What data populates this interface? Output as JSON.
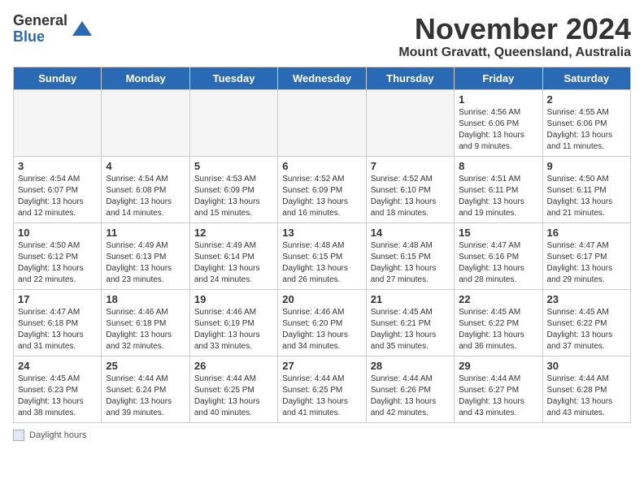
{
  "logo": {
    "general": "General",
    "blue": "Blue"
  },
  "title": "November 2024",
  "subtitle": "Mount Gravatt, Queensland, Australia",
  "days_of_week": [
    "Sunday",
    "Monday",
    "Tuesday",
    "Wednesday",
    "Thursday",
    "Friday",
    "Saturday"
  ],
  "footer_label": "Daylight hours",
  "weeks": [
    [
      {
        "day": "",
        "info": ""
      },
      {
        "day": "",
        "info": ""
      },
      {
        "day": "",
        "info": ""
      },
      {
        "day": "",
        "info": ""
      },
      {
        "day": "",
        "info": ""
      },
      {
        "day": "1",
        "info": "Sunrise: 4:56 AM\nSunset: 6:06 PM\nDaylight: 13 hours\nand 9 minutes."
      },
      {
        "day": "2",
        "info": "Sunrise: 4:55 AM\nSunset: 6:06 PM\nDaylight: 13 hours\nand 11 minutes."
      }
    ],
    [
      {
        "day": "3",
        "info": "Sunrise: 4:54 AM\nSunset: 6:07 PM\nDaylight: 13 hours\nand 12 minutes."
      },
      {
        "day": "4",
        "info": "Sunrise: 4:54 AM\nSunset: 6:08 PM\nDaylight: 13 hours\nand 14 minutes."
      },
      {
        "day": "5",
        "info": "Sunrise: 4:53 AM\nSunset: 6:09 PM\nDaylight: 13 hours\nand 15 minutes."
      },
      {
        "day": "6",
        "info": "Sunrise: 4:52 AM\nSunset: 6:09 PM\nDaylight: 13 hours\nand 16 minutes."
      },
      {
        "day": "7",
        "info": "Sunrise: 4:52 AM\nSunset: 6:10 PM\nDaylight: 13 hours\nand 18 minutes."
      },
      {
        "day": "8",
        "info": "Sunrise: 4:51 AM\nSunset: 6:11 PM\nDaylight: 13 hours\nand 19 minutes."
      },
      {
        "day": "9",
        "info": "Sunrise: 4:50 AM\nSunset: 6:11 PM\nDaylight: 13 hours\nand 21 minutes."
      }
    ],
    [
      {
        "day": "10",
        "info": "Sunrise: 4:50 AM\nSunset: 6:12 PM\nDaylight: 13 hours\nand 22 minutes."
      },
      {
        "day": "11",
        "info": "Sunrise: 4:49 AM\nSunset: 6:13 PM\nDaylight: 13 hours\nand 23 minutes."
      },
      {
        "day": "12",
        "info": "Sunrise: 4:49 AM\nSunset: 6:14 PM\nDaylight: 13 hours\nand 24 minutes."
      },
      {
        "day": "13",
        "info": "Sunrise: 4:48 AM\nSunset: 6:15 PM\nDaylight: 13 hours\nand 26 minutes."
      },
      {
        "day": "14",
        "info": "Sunrise: 4:48 AM\nSunset: 6:15 PM\nDaylight: 13 hours\nand 27 minutes."
      },
      {
        "day": "15",
        "info": "Sunrise: 4:47 AM\nSunset: 6:16 PM\nDaylight: 13 hours\nand 28 minutes."
      },
      {
        "day": "16",
        "info": "Sunrise: 4:47 AM\nSunset: 6:17 PM\nDaylight: 13 hours\nand 29 minutes."
      }
    ],
    [
      {
        "day": "17",
        "info": "Sunrise: 4:47 AM\nSunset: 6:18 PM\nDaylight: 13 hours\nand 31 minutes."
      },
      {
        "day": "18",
        "info": "Sunrise: 4:46 AM\nSunset: 6:18 PM\nDaylight: 13 hours\nand 32 minutes."
      },
      {
        "day": "19",
        "info": "Sunrise: 4:46 AM\nSunset: 6:19 PM\nDaylight: 13 hours\nand 33 minutes."
      },
      {
        "day": "20",
        "info": "Sunrise: 4:46 AM\nSunset: 6:20 PM\nDaylight: 13 hours\nand 34 minutes."
      },
      {
        "day": "21",
        "info": "Sunrise: 4:45 AM\nSunset: 6:21 PM\nDaylight: 13 hours\nand 35 minutes."
      },
      {
        "day": "22",
        "info": "Sunrise: 4:45 AM\nSunset: 6:22 PM\nDaylight: 13 hours\nand 36 minutes."
      },
      {
        "day": "23",
        "info": "Sunrise: 4:45 AM\nSunset: 6:22 PM\nDaylight: 13 hours\nand 37 minutes."
      }
    ],
    [
      {
        "day": "24",
        "info": "Sunrise: 4:45 AM\nSunset: 6:23 PM\nDaylight: 13 hours\nand 38 minutes."
      },
      {
        "day": "25",
        "info": "Sunrise: 4:44 AM\nSunset: 6:24 PM\nDaylight: 13 hours\nand 39 minutes."
      },
      {
        "day": "26",
        "info": "Sunrise: 4:44 AM\nSunset: 6:25 PM\nDaylight: 13 hours\nand 40 minutes."
      },
      {
        "day": "27",
        "info": "Sunrise: 4:44 AM\nSunset: 6:25 PM\nDaylight: 13 hours\nand 41 minutes."
      },
      {
        "day": "28",
        "info": "Sunrise: 4:44 AM\nSunset: 6:26 PM\nDaylight: 13 hours\nand 42 minutes."
      },
      {
        "day": "29",
        "info": "Sunrise: 4:44 AM\nSunset: 6:27 PM\nDaylight: 13 hours\nand 43 minutes."
      },
      {
        "day": "30",
        "info": "Sunrise: 4:44 AM\nSunset: 6:28 PM\nDaylight: 13 hours\nand 43 minutes."
      }
    ]
  ]
}
